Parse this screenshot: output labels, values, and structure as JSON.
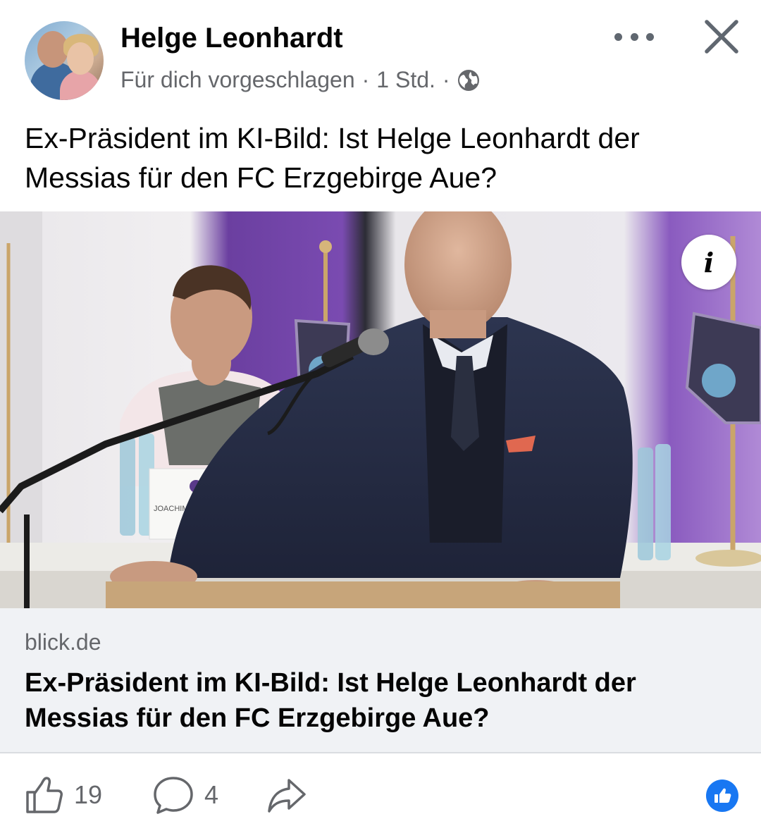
{
  "post": {
    "author": "Helge Leonhardt",
    "subtitle": "Für dich vorgeschlagen",
    "time": "1 Std.",
    "separator": "·",
    "text": "Ex-Präsident im KI-Bild: Ist Helge Leonhardt der Messias für den FC Erzgebirge Aue?"
  },
  "photo": {
    "nameplate": "JOACHIM ENGEL",
    "info_icon": "i"
  },
  "link": {
    "domain": "blick.de",
    "title": "Ex-Präsident im KI-Bild: Ist Helge Leonhardt der Messias für den FC Erzgebirge Aue?"
  },
  "actions": {
    "likes": "19",
    "comments": "4"
  },
  "icons": {
    "more": "more-dots-icon",
    "close": "close-icon",
    "privacy": "globe-icon",
    "like": "thumbs-up-icon",
    "comment": "comment-icon",
    "share": "share-icon",
    "reaction": "like-reaction-icon"
  },
  "colors": {
    "brand_blue": "#1877f2",
    "secondary_text": "#65676b",
    "card_bg": "#f0f2f5"
  }
}
